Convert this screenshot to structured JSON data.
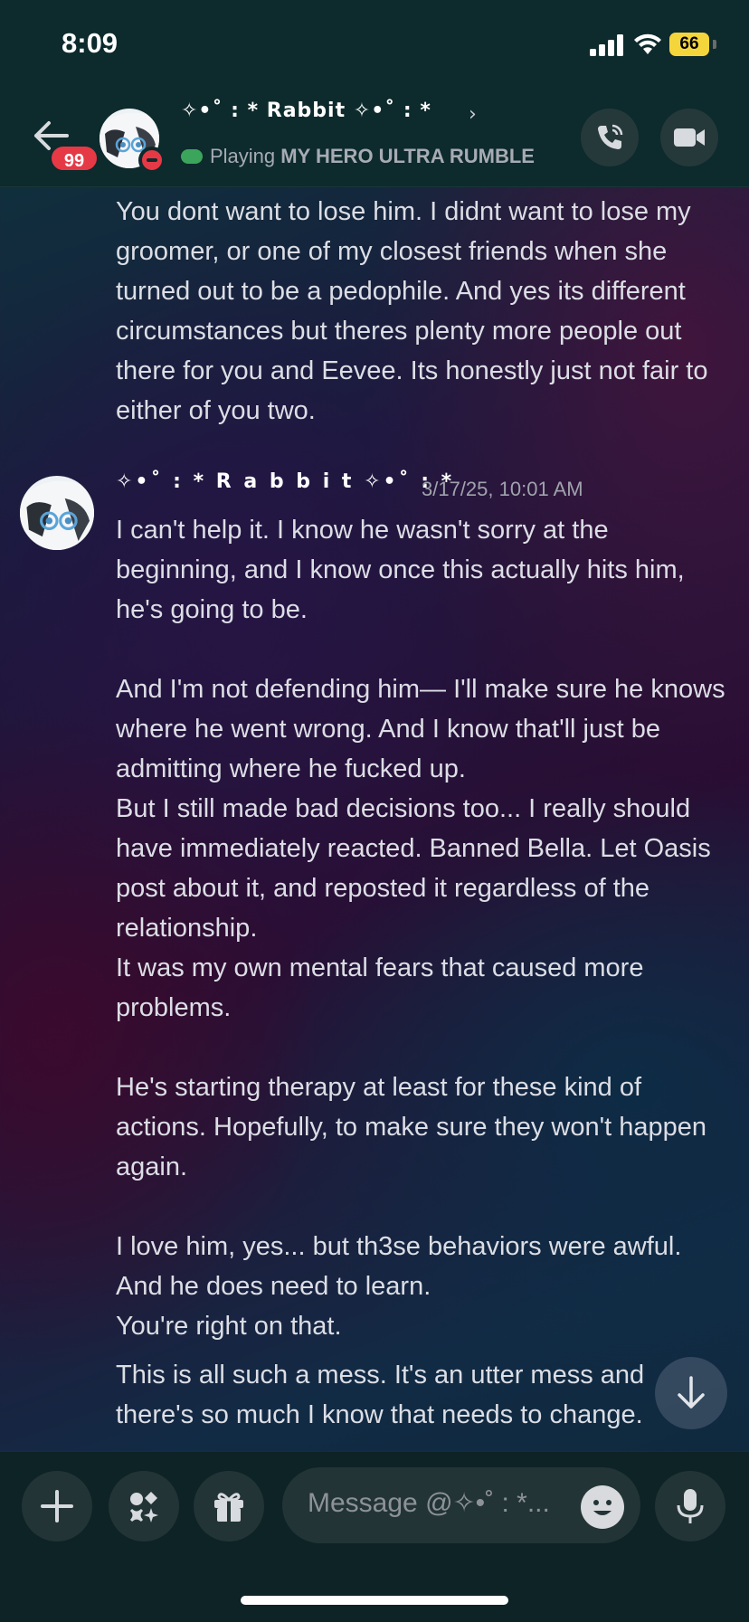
{
  "status_bar": {
    "time": "8:09",
    "battery": "66"
  },
  "header": {
    "unread_badge": "99",
    "name": "✧•˚ : * Rabbit ✧•˚ : *",
    "chevron": "›",
    "activity_prefix": "Playing",
    "activity_game": "MY HERO ULTRA RUMBLE",
    "icons": [
      "back-arrow-icon",
      "phone-icon",
      "video-camera-icon"
    ]
  },
  "messages": [
    {
      "text": "You dont want to lose him. I didnt want to lose my groomer, or one of my closest friends when she turned out to be a pedophile. And yes its different circumstances but theres plenty more people out there for you and Eevee. Its honestly just not fair to either of you two."
    },
    {
      "author": "✧•˚ : * R a b b i t ✧•˚ : *",
      "timestamp": "3/17/25, 10:01 AM",
      "text": "I can't help it. I know he wasn't sorry at the beginning, and I know once this actually hits him, he's going to be.\n\nAnd I'm not defending him— I'll make sure he knows where he went wrong. And I know that'll just be admitting where he fucked up.\nBut I still made bad decisions too... I really should have immediately reacted. Banned Bella. Let Oasis post about it, and reposted it regardless of the relationship.\nIt was my own mental fears that caused more problems.\n\nHe's starting therapy at least for these kind of actions. Hopefully, to make sure they won't happen again.\n\nI love him, yes... but th3se behaviors were awful. And he does need to learn.\nYou're right on that.",
      "followup": "This is all such a mess. It's an utter mess and there's so much I know that needs to change."
    }
  ],
  "composer": {
    "placeholder": "Message @✧•˚ : *...",
    "icons": [
      "plus-icon",
      "apps-icon",
      "gift-icon",
      "emoji-icon",
      "microphone-icon"
    ]
  }
}
